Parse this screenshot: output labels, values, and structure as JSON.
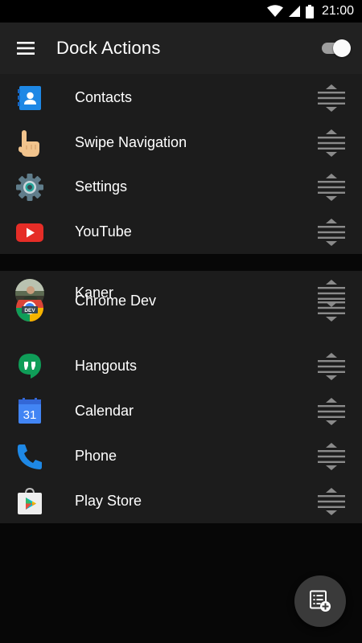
{
  "status_bar": {
    "time": "21:00",
    "icons": [
      "wifi-icon",
      "signal-icon",
      "battery-icon"
    ]
  },
  "app_bar": {
    "title": "Dock Actions",
    "menu_icon": "menu-icon",
    "toggle_on": true
  },
  "dock_actions": [
    {
      "label": "Contacts",
      "icon": "contacts-icon"
    },
    {
      "label": "Swipe Navigation",
      "icon": "pointing-hand-icon"
    },
    {
      "label": "Settings",
      "icon": "gear-icon"
    },
    {
      "label": "YouTube",
      "icon": "youtube-icon"
    }
  ],
  "apps": [
    {
      "label": "Kaner",
      "icon": "avatar-photo-icon"
    },
    {
      "label": "Chrome Dev",
      "icon": "chrome-dev-icon",
      "icon_text": "DEV"
    },
    {
      "label": "Hangouts",
      "icon": "hangouts-icon"
    },
    {
      "label": "Calendar",
      "icon": "calendar-icon",
      "icon_text": "31"
    },
    {
      "label": "Phone",
      "icon": "phone-icon"
    },
    {
      "label": "Play Store",
      "icon": "play-store-icon"
    }
  ],
  "fab": {
    "icon": "add-list-icon"
  },
  "colors": {
    "background": "#070707",
    "app_bar": "#212121",
    "list_background": "#1c1c1c",
    "handle": "#8a8a8a",
    "fab": "#3a3a3a"
  }
}
